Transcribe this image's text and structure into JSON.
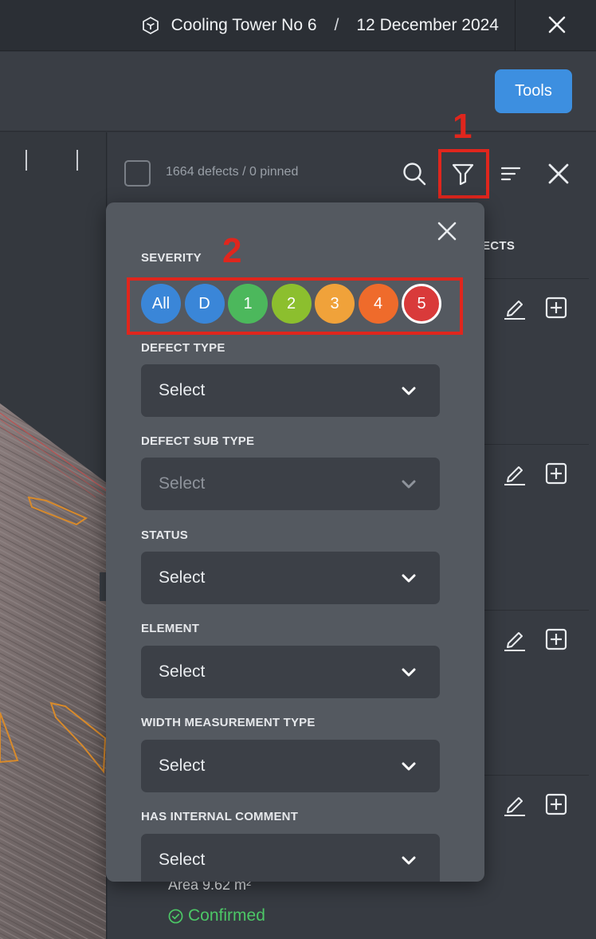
{
  "header": {
    "asset_name": "Cooling Tower No 6",
    "separator": "/",
    "date": "12 December 2024",
    "icons": [
      "cube-icon",
      "close-icon"
    ]
  },
  "toolbar": {
    "tools_label": "Tools"
  },
  "defects_panel": {
    "count_text": "1664 defects / 0 pinned",
    "column_label_partial": "ECTS",
    "header_icons": [
      "search-icon",
      "filter-icon",
      "sort-icon",
      "close-icon"
    ],
    "row_icons": [
      "edit-icon",
      "add-box-icon"
    ],
    "visible_row": {
      "area_text": "Area 9.62 m²",
      "status_text": "Confirmed"
    }
  },
  "annotations": {
    "filter_marker": "1",
    "severity_marker": "2",
    "color": "#e0261d"
  },
  "filter_popover": {
    "severity": {
      "label": "SEVERITY",
      "chips": [
        {
          "label": "All",
          "color": "#3a86d8",
          "selected": false
        },
        {
          "label": "D",
          "color": "#3a86d8",
          "selected": false
        },
        {
          "label": "1",
          "color": "#4cb85c",
          "selected": false
        },
        {
          "label": "2",
          "color": "#8cbf2e",
          "selected": false
        },
        {
          "label": "3",
          "color": "#f0a23a",
          "selected": false
        },
        {
          "label": "4",
          "color": "#ef6b2b",
          "selected": false
        },
        {
          "label": "5",
          "color": "#d93a3a",
          "selected": true
        }
      ]
    },
    "defect_type": {
      "label": "DEFECT TYPE",
      "value": "Select",
      "disabled": false
    },
    "defect_sub_type": {
      "label": "DEFECT SUB TYPE",
      "value": "Select",
      "disabled": true
    },
    "status": {
      "label": "STATUS",
      "value": "Select",
      "disabled": false
    },
    "element": {
      "label": "ELEMENT",
      "value": "Select",
      "disabled": false
    },
    "width_measurement_type": {
      "label": "WIDTH MEASUREMENT TYPE",
      "value": "Select",
      "disabled": false
    },
    "has_internal_comment": {
      "label": "HAS INTERNAL COMMENT",
      "value": "Select",
      "disabled": false
    }
  },
  "colors": {
    "accent_blue": "#3d8fe0",
    "confirmed_green": "#4cc766"
  }
}
